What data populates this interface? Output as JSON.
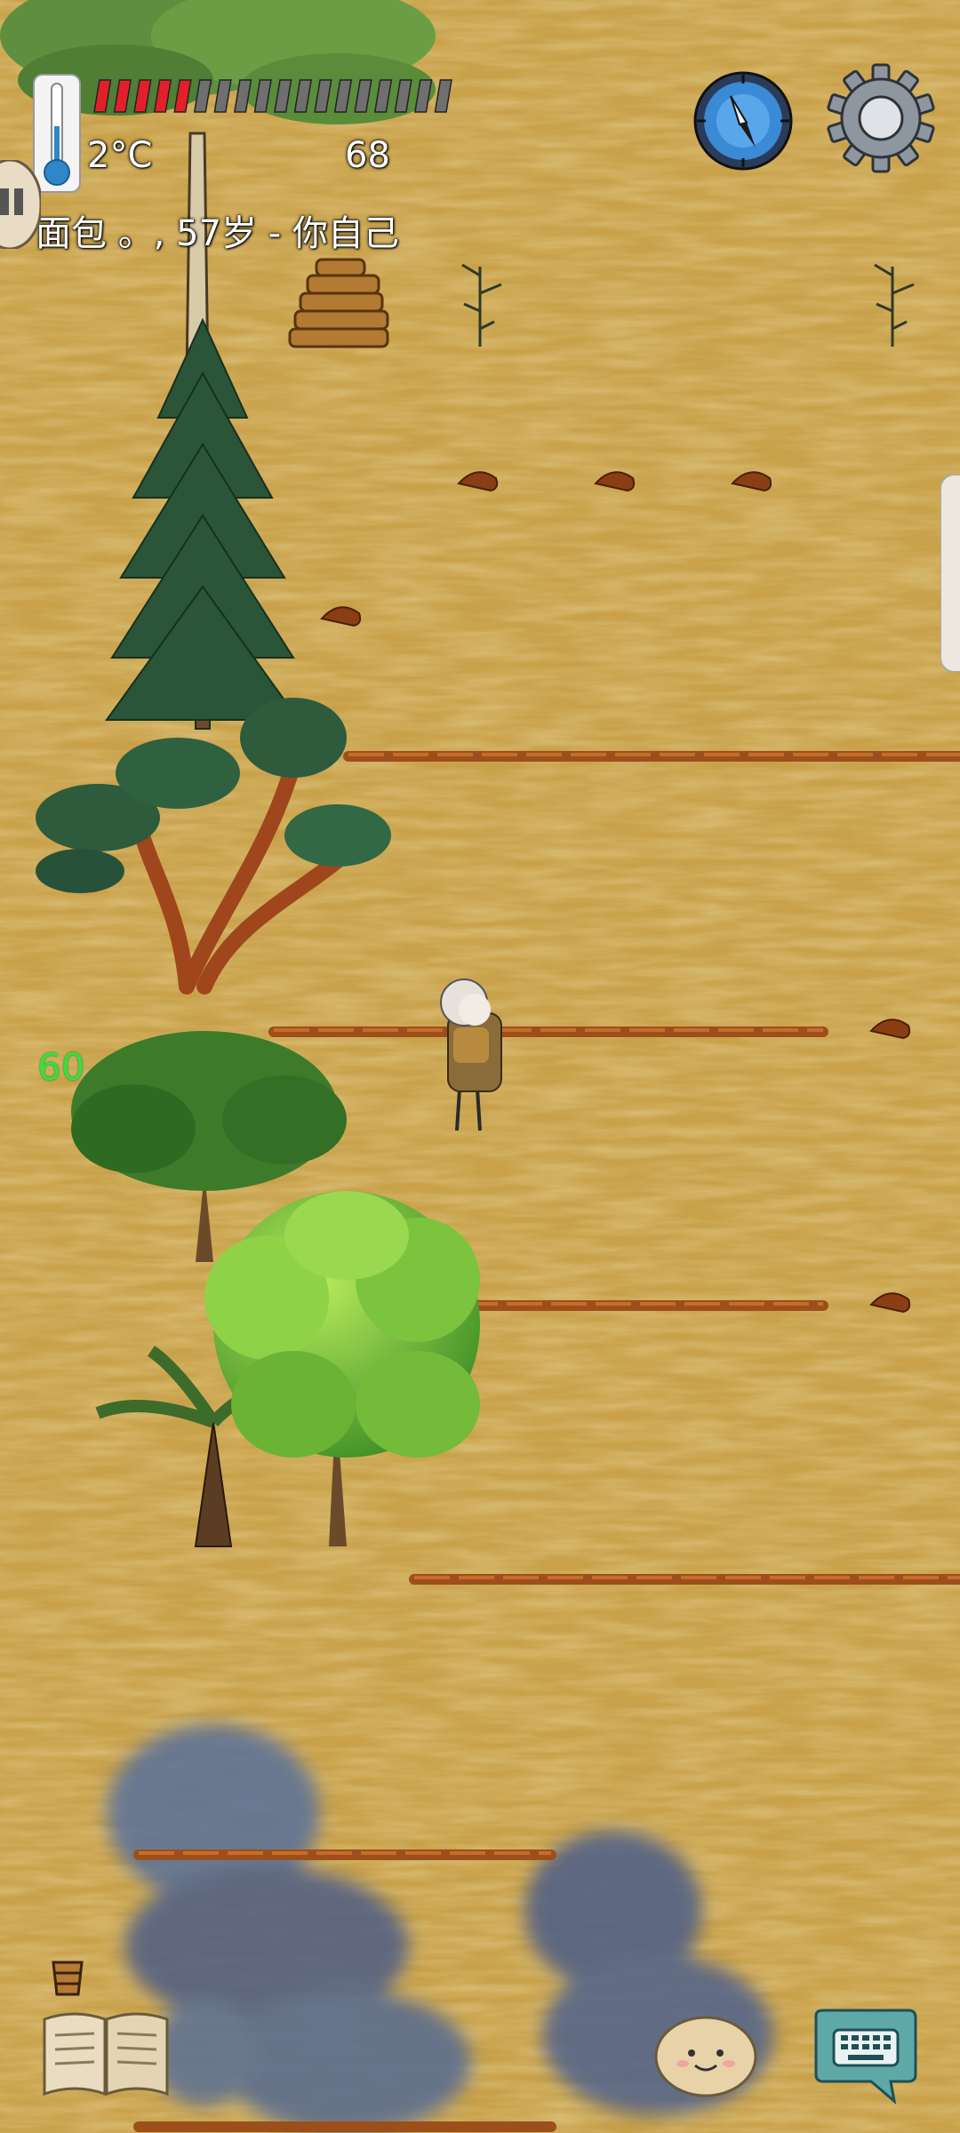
{
  "hud": {
    "temperature": "2°C",
    "food_value": "68",
    "player_line": "面包 。, 57岁 - 你自己",
    "food_pips_filled": 5,
    "food_pips_total": 18,
    "color_food": "#e3202a",
    "icons": [
      "thermometer-icon",
      "compass-icon",
      "gear-icon",
      "recipe-book-icon",
      "emote-icon",
      "keyboard-chat-icon",
      "bucket-icon"
    ]
  },
  "floating_number": "60",
  "colors": {
    "ground": "#c9a24a",
    "furrow": "#a5531d",
    "water": "#4e5f86",
    "pine": "#2d5b3c"
  }
}
